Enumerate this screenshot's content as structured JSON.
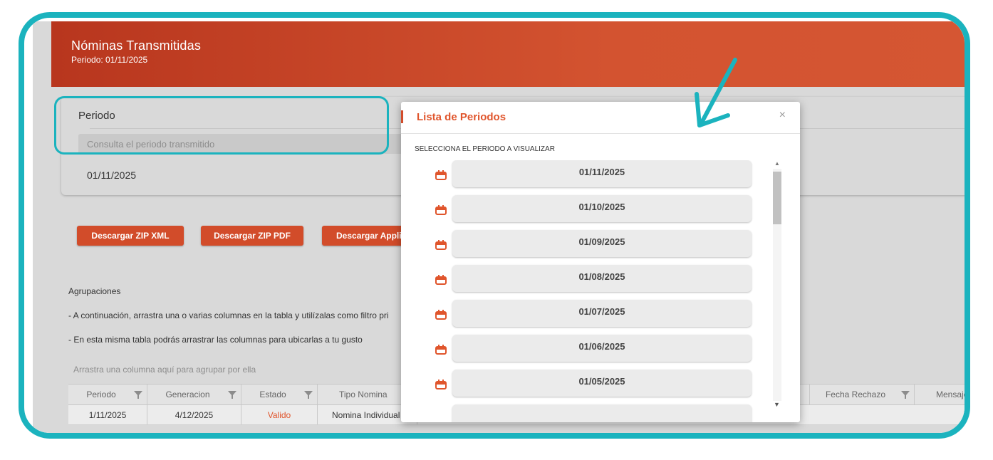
{
  "header": {
    "title": "Nóminas Transmitidas",
    "subtitle": "Periodo: 01/11/2025"
  },
  "periodo": {
    "label": "Periodo",
    "placeholder": "Consulta el periodo transmitido",
    "value": "01/11/2025"
  },
  "buttons": {
    "zip_xml": "Descargar ZIP XML",
    "zip_pdf": "Descargar ZIP PDF",
    "application": "Descargar Applica"
  },
  "agrupaciones": {
    "title": "Agrupaciones",
    "note1": "- A continuación, arrastra una o varias columnas en la tabla y utilízalas como filtro pri",
    "note2": "- En esta misma tabla podrás arrastrar las columnas para ubicarlas a tu gusto",
    "drop_hint": "Arrastra una columna aquí para agrupar por ella"
  },
  "grid": {
    "columns": [
      "Periodo",
      "Generacion",
      "Estado",
      "Tipo Nomina",
      "Fecha Rechazo",
      "Mensaje Rec"
    ],
    "row1": {
      "periodo": "1/11/2025",
      "generacion": "4/12/2025",
      "estado": "Valido",
      "tipo": "Nomina Individual"
    }
  },
  "modal": {
    "title": "Lista de Periodos",
    "close": "×",
    "subtitle": "SELECCIONA EL PERIODO A VISUALIZAR",
    "periods": [
      "01/11/2025",
      "01/10/2025",
      "01/09/2025",
      "01/08/2025",
      "01/07/2025",
      "01/06/2025",
      "01/05/2025"
    ]
  },
  "colors": {
    "accent": "#d24c2a",
    "highlight": "#1bb3be",
    "estado_valido": "#e0552c"
  }
}
